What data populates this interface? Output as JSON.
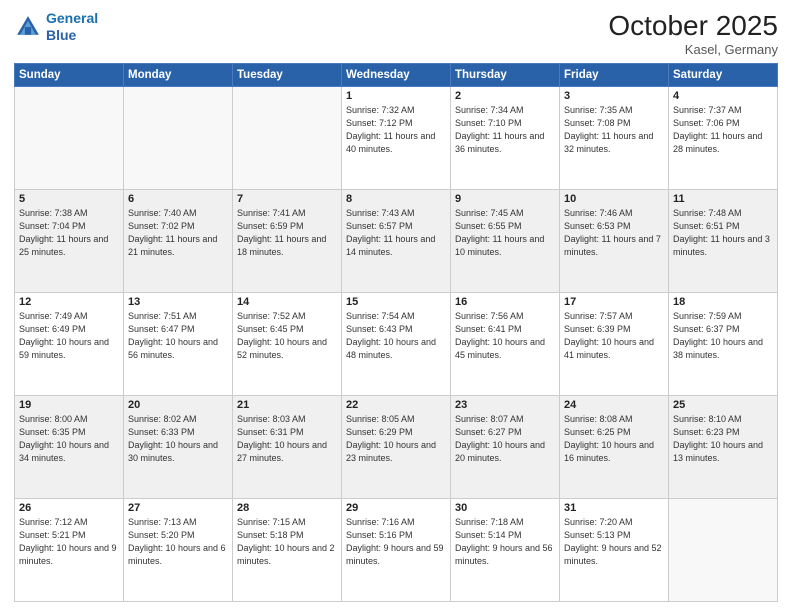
{
  "header": {
    "logo_line1": "General",
    "logo_line2": "Blue",
    "month": "October 2025",
    "location": "Kasel, Germany"
  },
  "weekdays": [
    "Sunday",
    "Monday",
    "Tuesday",
    "Wednesday",
    "Thursday",
    "Friday",
    "Saturday"
  ],
  "weeks": [
    [
      {
        "day": "",
        "info": ""
      },
      {
        "day": "",
        "info": ""
      },
      {
        "day": "",
        "info": ""
      },
      {
        "day": "1",
        "info": "Sunrise: 7:32 AM\nSunset: 7:12 PM\nDaylight: 11 hours\nand 40 minutes."
      },
      {
        "day": "2",
        "info": "Sunrise: 7:34 AM\nSunset: 7:10 PM\nDaylight: 11 hours\nand 36 minutes."
      },
      {
        "day": "3",
        "info": "Sunrise: 7:35 AM\nSunset: 7:08 PM\nDaylight: 11 hours\nand 32 minutes."
      },
      {
        "day": "4",
        "info": "Sunrise: 7:37 AM\nSunset: 7:06 PM\nDaylight: 11 hours\nand 28 minutes."
      }
    ],
    [
      {
        "day": "5",
        "info": "Sunrise: 7:38 AM\nSunset: 7:04 PM\nDaylight: 11 hours\nand 25 minutes."
      },
      {
        "day": "6",
        "info": "Sunrise: 7:40 AM\nSunset: 7:02 PM\nDaylight: 11 hours\nand 21 minutes."
      },
      {
        "day": "7",
        "info": "Sunrise: 7:41 AM\nSunset: 6:59 PM\nDaylight: 11 hours\nand 18 minutes."
      },
      {
        "day": "8",
        "info": "Sunrise: 7:43 AM\nSunset: 6:57 PM\nDaylight: 11 hours\nand 14 minutes."
      },
      {
        "day": "9",
        "info": "Sunrise: 7:45 AM\nSunset: 6:55 PM\nDaylight: 11 hours\nand 10 minutes."
      },
      {
        "day": "10",
        "info": "Sunrise: 7:46 AM\nSunset: 6:53 PM\nDaylight: 11 hours\nand 7 minutes."
      },
      {
        "day": "11",
        "info": "Sunrise: 7:48 AM\nSunset: 6:51 PM\nDaylight: 11 hours\nand 3 minutes."
      }
    ],
    [
      {
        "day": "12",
        "info": "Sunrise: 7:49 AM\nSunset: 6:49 PM\nDaylight: 10 hours\nand 59 minutes."
      },
      {
        "day": "13",
        "info": "Sunrise: 7:51 AM\nSunset: 6:47 PM\nDaylight: 10 hours\nand 56 minutes."
      },
      {
        "day": "14",
        "info": "Sunrise: 7:52 AM\nSunset: 6:45 PM\nDaylight: 10 hours\nand 52 minutes."
      },
      {
        "day": "15",
        "info": "Sunrise: 7:54 AM\nSunset: 6:43 PM\nDaylight: 10 hours\nand 48 minutes."
      },
      {
        "day": "16",
        "info": "Sunrise: 7:56 AM\nSunset: 6:41 PM\nDaylight: 10 hours\nand 45 minutes."
      },
      {
        "day": "17",
        "info": "Sunrise: 7:57 AM\nSunset: 6:39 PM\nDaylight: 10 hours\nand 41 minutes."
      },
      {
        "day": "18",
        "info": "Sunrise: 7:59 AM\nSunset: 6:37 PM\nDaylight: 10 hours\nand 38 minutes."
      }
    ],
    [
      {
        "day": "19",
        "info": "Sunrise: 8:00 AM\nSunset: 6:35 PM\nDaylight: 10 hours\nand 34 minutes."
      },
      {
        "day": "20",
        "info": "Sunrise: 8:02 AM\nSunset: 6:33 PM\nDaylight: 10 hours\nand 30 minutes."
      },
      {
        "day": "21",
        "info": "Sunrise: 8:03 AM\nSunset: 6:31 PM\nDaylight: 10 hours\nand 27 minutes."
      },
      {
        "day": "22",
        "info": "Sunrise: 8:05 AM\nSunset: 6:29 PM\nDaylight: 10 hours\nand 23 minutes."
      },
      {
        "day": "23",
        "info": "Sunrise: 8:07 AM\nSunset: 6:27 PM\nDaylight: 10 hours\nand 20 minutes."
      },
      {
        "day": "24",
        "info": "Sunrise: 8:08 AM\nSunset: 6:25 PM\nDaylight: 10 hours\nand 16 minutes."
      },
      {
        "day": "25",
        "info": "Sunrise: 8:10 AM\nSunset: 6:23 PM\nDaylight: 10 hours\nand 13 minutes."
      }
    ],
    [
      {
        "day": "26",
        "info": "Sunrise: 7:12 AM\nSunset: 5:21 PM\nDaylight: 10 hours\nand 9 minutes."
      },
      {
        "day": "27",
        "info": "Sunrise: 7:13 AM\nSunset: 5:20 PM\nDaylight: 10 hours\nand 6 minutes."
      },
      {
        "day": "28",
        "info": "Sunrise: 7:15 AM\nSunset: 5:18 PM\nDaylight: 10 hours\nand 2 minutes."
      },
      {
        "day": "29",
        "info": "Sunrise: 7:16 AM\nSunset: 5:16 PM\nDaylight: 9 hours\nand 59 minutes."
      },
      {
        "day": "30",
        "info": "Sunrise: 7:18 AM\nSunset: 5:14 PM\nDaylight: 9 hours\nand 56 minutes."
      },
      {
        "day": "31",
        "info": "Sunrise: 7:20 AM\nSunset: 5:13 PM\nDaylight: 9 hours\nand 52 minutes."
      },
      {
        "day": "",
        "info": ""
      }
    ]
  ]
}
